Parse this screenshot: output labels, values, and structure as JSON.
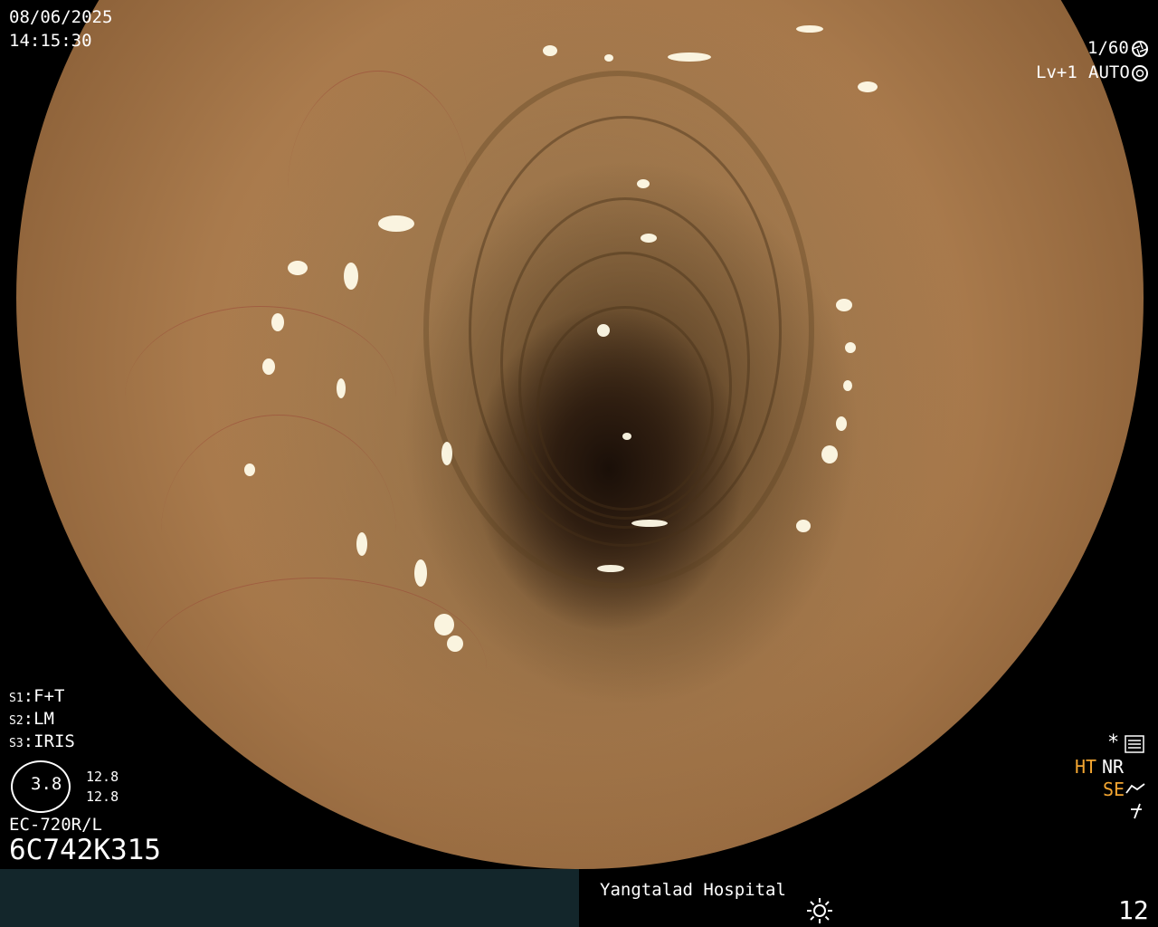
{
  "datetime": {
    "date": "08/06/2025",
    "time": "14:15:30"
  },
  "top_right": {
    "shutter": "1/60",
    "level": "Lv+1",
    "mode": "AUTO"
  },
  "settings": {
    "s1_label": "S1",
    "s1_value": "F+T",
    "s2_label": "S2",
    "s2_value": "LM",
    "s3_label": "S3",
    "s3_value": "IRIS"
  },
  "gauge": {
    "center_value": "3.8",
    "upper_value": "12.8",
    "lower_value": "12.8"
  },
  "scope": {
    "model": "EC-720R/L",
    "serial": "6C742K315"
  },
  "right_status": {
    "asterisk": "*",
    "ht": "HT",
    "nr": "NR",
    "se": "SE"
  },
  "footer": {
    "hospital": "Yangtalad Hospital",
    "number": "12"
  },
  "colors": {
    "footer_left_bg": "#13262b",
    "accent_orange": "#f2a531"
  },
  "icons": [
    "aperture-icon",
    "auto-iris-icon",
    "menu-settings-icon",
    "structure-enhance-icon",
    "lightning-icon",
    "brightness-sun-icon"
  ]
}
